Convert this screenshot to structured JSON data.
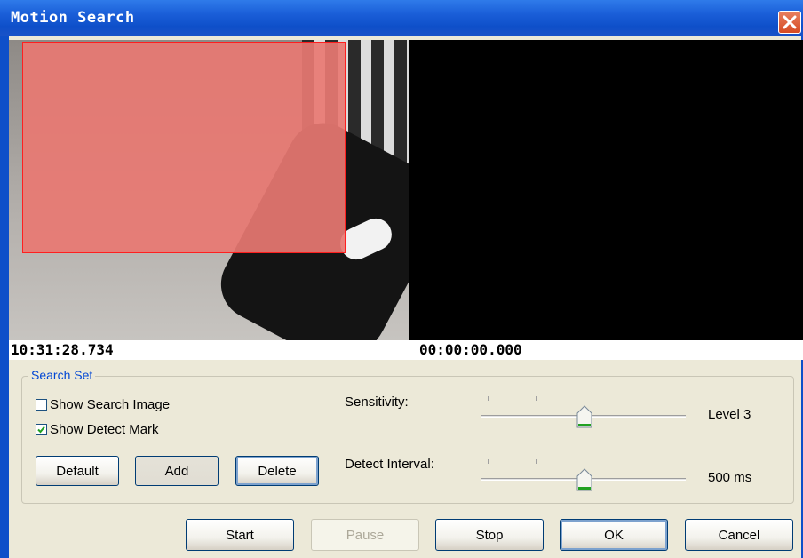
{
  "window": {
    "title": "Motion Search"
  },
  "video": {
    "left_time": "10:31:28.734",
    "right_time": "00:00:00.000"
  },
  "search_set": {
    "legend": "Search Set",
    "show_search_image": {
      "label": "Show Search Image",
      "checked": false
    },
    "show_detect_mark": {
      "label": "Show Detect Mark",
      "checked": true
    },
    "buttons": {
      "default": "Default",
      "add": "Add",
      "delete": "Delete"
    },
    "sensitivity": {
      "label": "Sensitivity:",
      "value": "Level 3",
      "position": 3,
      "max": 5
    },
    "detect_interval": {
      "label": "Detect Interval:",
      "value": "500 ms",
      "position": 3,
      "max": 5
    }
  },
  "footer": {
    "start": "Start",
    "pause": "Pause",
    "stop": "Stop",
    "ok": "OK",
    "cancel": "Cancel"
  },
  "colors": {
    "title_bar": "#0E4FC9",
    "detect_region": "#E87872",
    "accent": "#0046D5"
  }
}
